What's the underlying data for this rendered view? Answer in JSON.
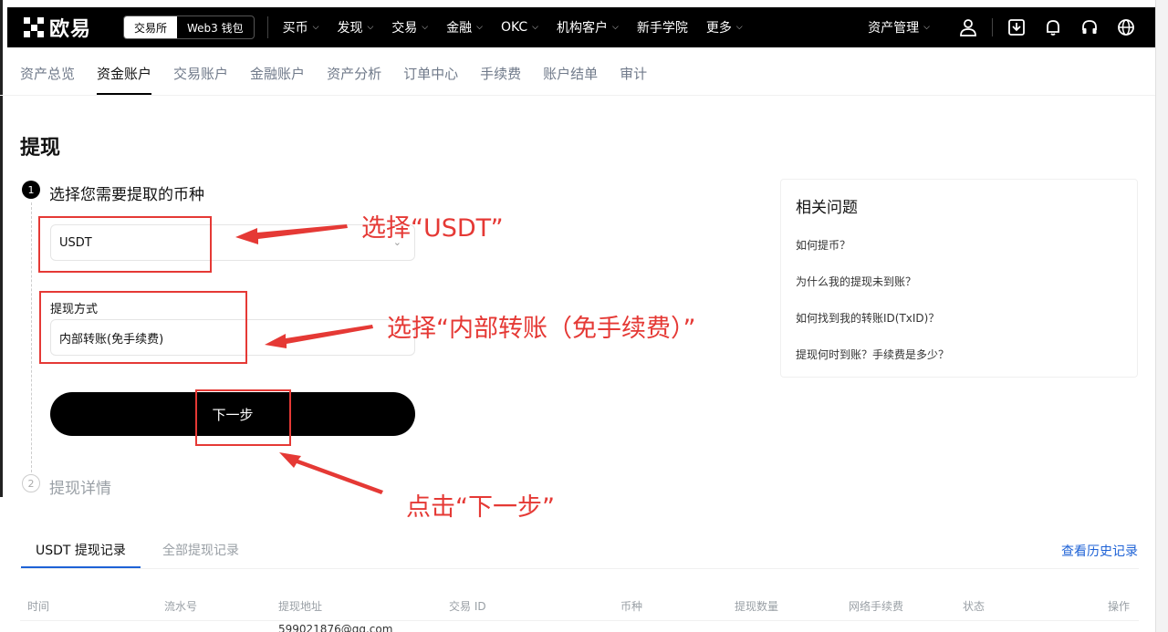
{
  "topnav": {
    "logo_text": "欧易",
    "switch": [
      "交易所",
      "Web3 钱包"
    ],
    "items": [
      {
        "label": "买币",
        "dropdown": true
      },
      {
        "label": "发现",
        "dropdown": true
      },
      {
        "label": "交易",
        "dropdown": true
      },
      {
        "label": "金融",
        "dropdown": true
      },
      {
        "label": "OKC",
        "dropdown": true
      },
      {
        "label": "机构客户",
        "dropdown": true
      },
      {
        "label": "新手学院",
        "dropdown": false
      },
      {
        "label": "更多",
        "dropdown": true
      }
    ],
    "asset_management": "资产管理",
    "icons": [
      "user-icon",
      "download-icon",
      "bell-icon",
      "headset-icon",
      "globe-icon"
    ]
  },
  "subnav": {
    "items": [
      "资产总览",
      "资金账户",
      "交易账户",
      "金融账户",
      "资产分析",
      "订单中心",
      "手续费",
      "账户结单",
      "审计"
    ],
    "active_index": 1
  },
  "page": {
    "title": "提现",
    "step1": {
      "number": "1",
      "label": "选择您需要提取的币种"
    },
    "coin_value": "USDT",
    "method_label": "提现方式",
    "method_value": "内部转账(免手续费)",
    "next_button": "下一步",
    "step2": {
      "number": "2",
      "label": "提现详情"
    }
  },
  "faq": {
    "title": "相关问题",
    "items": [
      "如何提币？",
      "为什么我的提现未到账？",
      "如何找到我的转账ID(TxID)？",
      "提现何时到账？手续费是多少？"
    ]
  },
  "annotations": {
    "select_usdt": "选择“USDT”",
    "select_method": "选择“内部转账（免手续费）”",
    "click_next": "点击“下一步”",
    "color": "#e53935"
  },
  "records": {
    "tabs": [
      "USDT 提现记录",
      "全部提现记录"
    ],
    "history_link": "查看历史记录",
    "columns": [
      "时间",
      "流水号",
      "提现地址",
      "交易 ID",
      "币种",
      "提现数量",
      "网络手续费",
      "状态",
      "操作"
    ],
    "first_row_address": "599021876@qq.com"
  },
  "colors": {
    "primary": "#000000",
    "link": "#1e62d6",
    "accent_red": "#e53935"
  }
}
